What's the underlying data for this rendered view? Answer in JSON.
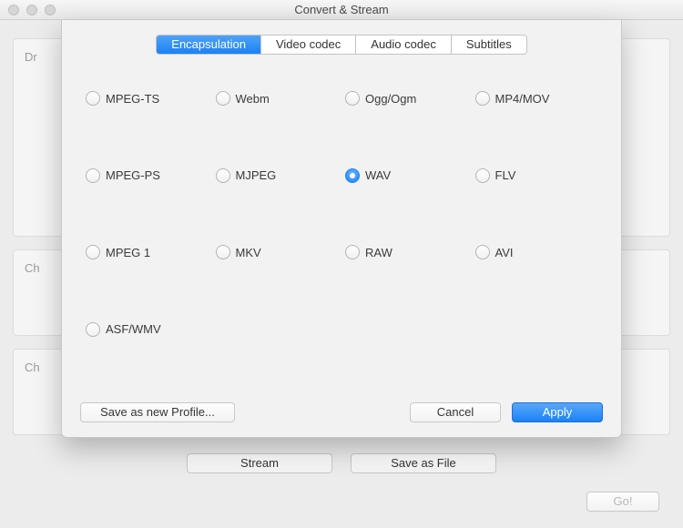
{
  "window": {
    "title": "Convert & Stream"
  },
  "background": {
    "panel1_hint": "Dr",
    "panel2_hint": "Ch",
    "panel3_hint": "Ch",
    "stream_label": "Stream",
    "save_file_label": "Save as File",
    "go_label": "Go!"
  },
  "sheet": {
    "tabs": [
      {
        "label": "Encapsulation",
        "selected": true
      },
      {
        "label": "Video codec",
        "selected": false
      },
      {
        "label": "Audio codec",
        "selected": false
      },
      {
        "label": "Subtitles",
        "selected": false
      }
    ],
    "options": [
      {
        "label": "MPEG-TS",
        "selected": false
      },
      {
        "label": "Webm",
        "selected": false
      },
      {
        "label": "Ogg/Ogm",
        "selected": false
      },
      {
        "label": "MP4/MOV",
        "selected": false
      },
      {
        "label": "MPEG-PS",
        "selected": false
      },
      {
        "label": "MJPEG",
        "selected": false
      },
      {
        "label": "WAV",
        "selected": true
      },
      {
        "label": "FLV",
        "selected": false
      },
      {
        "label": "MPEG 1",
        "selected": false
      },
      {
        "label": "MKV",
        "selected": false
      },
      {
        "label": "RAW",
        "selected": false
      },
      {
        "label": "AVI",
        "selected": false
      },
      {
        "label": "ASF/WMV",
        "selected": false
      }
    ],
    "save_profile_label": "Save as new Profile...",
    "cancel_label": "Cancel",
    "apply_label": "Apply"
  }
}
